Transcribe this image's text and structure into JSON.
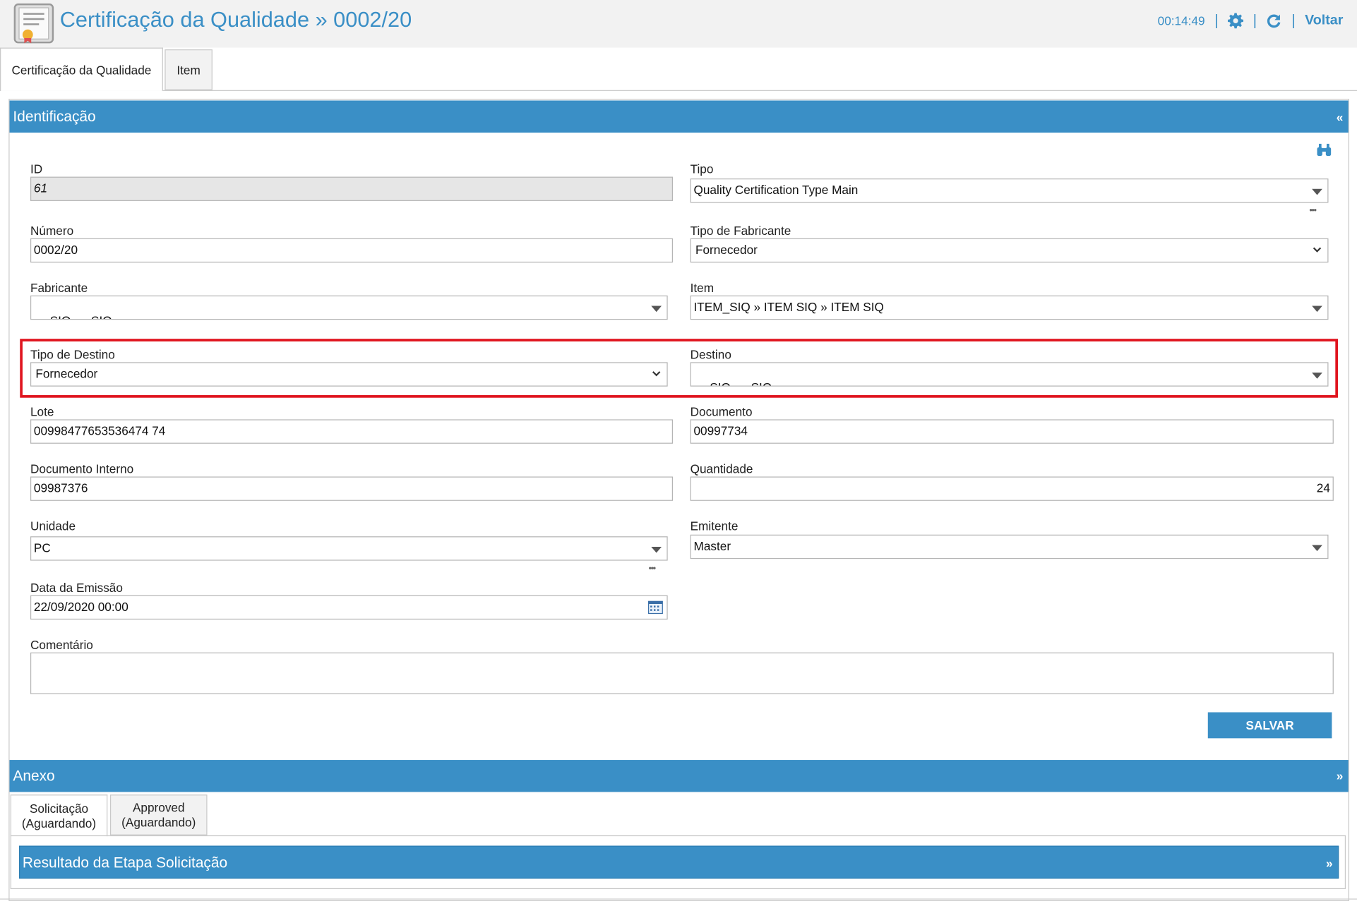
{
  "header": {
    "title": "Certificação da Qualidade » 0002/20",
    "timer": "00:14:49",
    "separator": "|",
    "back_label": "Voltar",
    "settings_icon": "gear-icon",
    "refresh_icon": "refresh-icon"
  },
  "tabs": [
    {
      "label": "Certificação da Qualidade",
      "active": true
    },
    {
      "label": "Item",
      "active": false
    }
  ],
  "identificacao": {
    "title": "Identificação",
    "toggle": "«",
    "fields": {
      "id": {
        "label": "ID",
        "value": "61"
      },
      "tipo": {
        "label": "Tipo",
        "value": "Quality Certification Type Main"
      },
      "numero": {
        "label": "Número",
        "value": "0002/20"
      },
      "tipo_fabricante": {
        "label": "Tipo de Fabricante",
        "value": "Fornecedor"
      },
      "fabricante": {
        "label": "Fabricante",
        "value": "SIQ  »  SIQ"
      },
      "item": {
        "label": "Item",
        "value": "ITEM_SIQ » ITEM SIQ » ITEM SIQ"
      },
      "tipo_destino": {
        "label": "Tipo de Destino",
        "value": "Fornecedor"
      },
      "destino": {
        "label": "Destino",
        "value": "SIQ  »  SIQ"
      },
      "lote": {
        "label": "Lote",
        "value": "00998477653536474 74"
      },
      "documento": {
        "label": "Documento",
        "value": "00997734"
      },
      "documento_interno": {
        "label": "Documento Interno",
        "value": "09987376"
      },
      "quantidade": {
        "label": "Quantidade",
        "value": "24"
      },
      "unidade": {
        "label": "Unidade",
        "value": "PC"
      },
      "emitente": {
        "label": "Emitente",
        "value": "Master"
      },
      "data_emissao": {
        "label": "Data da Emissão",
        "value": "22/09/2020 00:00"
      },
      "comentario": {
        "label": "Comentário",
        "value": ""
      }
    },
    "more_dots": "•••",
    "save_label": "SALVAR"
  },
  "anexo": {
    "title": "Anexo",
    "toggle": "»",
    "sub_tabs": [
      {
        "line1": "Solicitação",
        "line2": "(Aguardando)",
        "active": true
      },
      {
        "line1": "Approved",
        "line2": "(Aguardando)",
        "active": false
      }
    ],
    "result_panel": {
      "title": "Resultado da Etapa Solicitação",
      "toggle": "»"
    }
  },
  "colors": {
    "accent": "#3a8fc6",
    "highlight": "#e0141e"
  }
}
